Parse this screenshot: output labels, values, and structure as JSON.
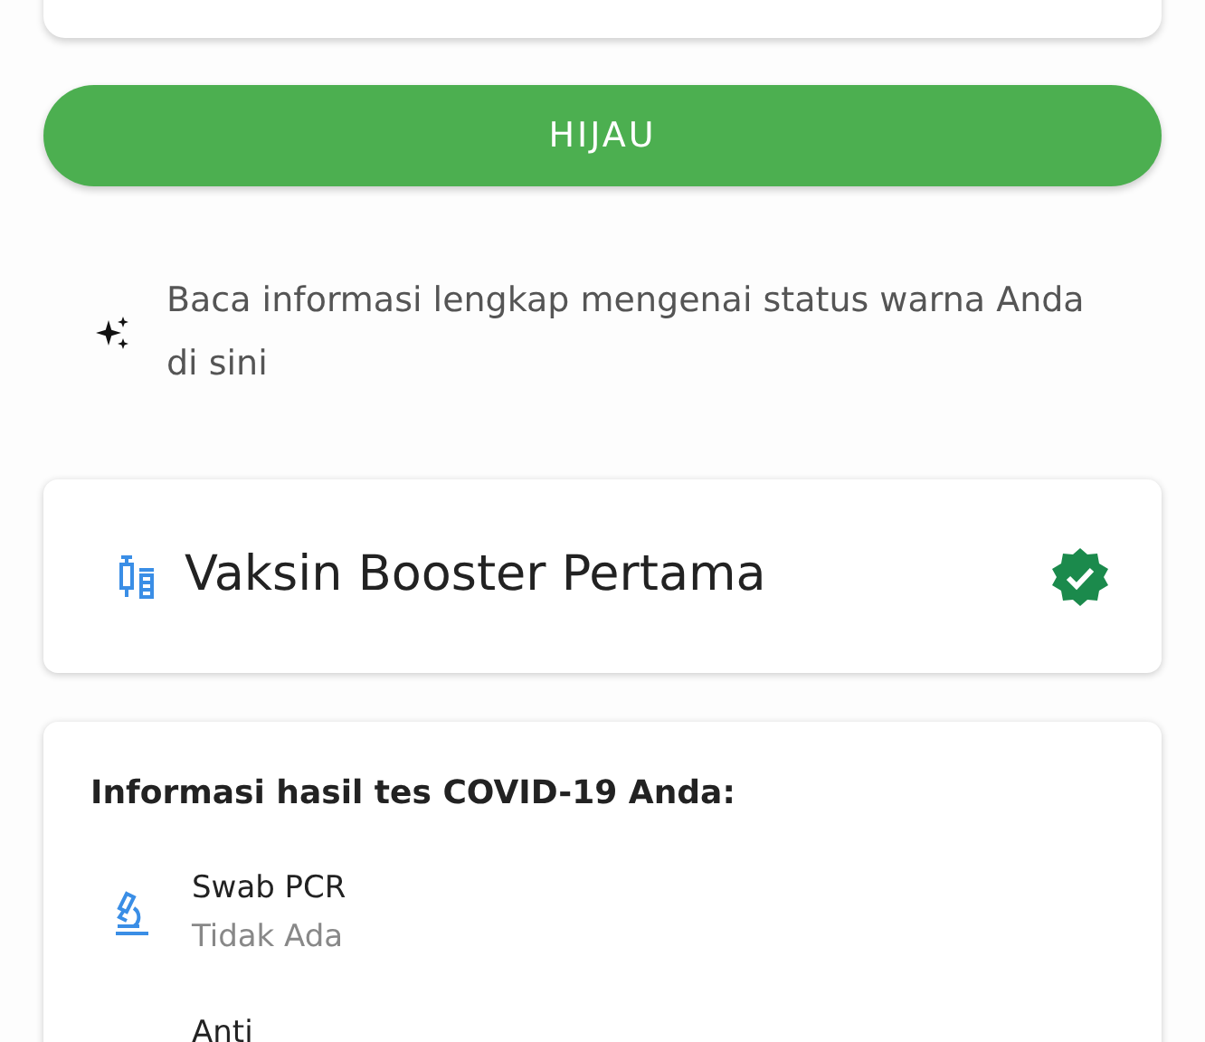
{
  "status_button": {
    "label": "HIJAU"
  },
  "info": {
    "text": "Baca informasi lengkap mengenai status warna Anda",
    "link": "di sini"
  },
  "vaccine_card": {
    "title": "Vaksin Booster Pertama",
    "verified": true
  },
  "test_results": {
    "title": "Informasi hasil tes COVID-19 Anda:",
    "items": [
      {
        "name": "Swab PCR",
        "result": "Tidak Ada"
      },
      {
        "name": "Anti"
      }
    ]
  }
}
